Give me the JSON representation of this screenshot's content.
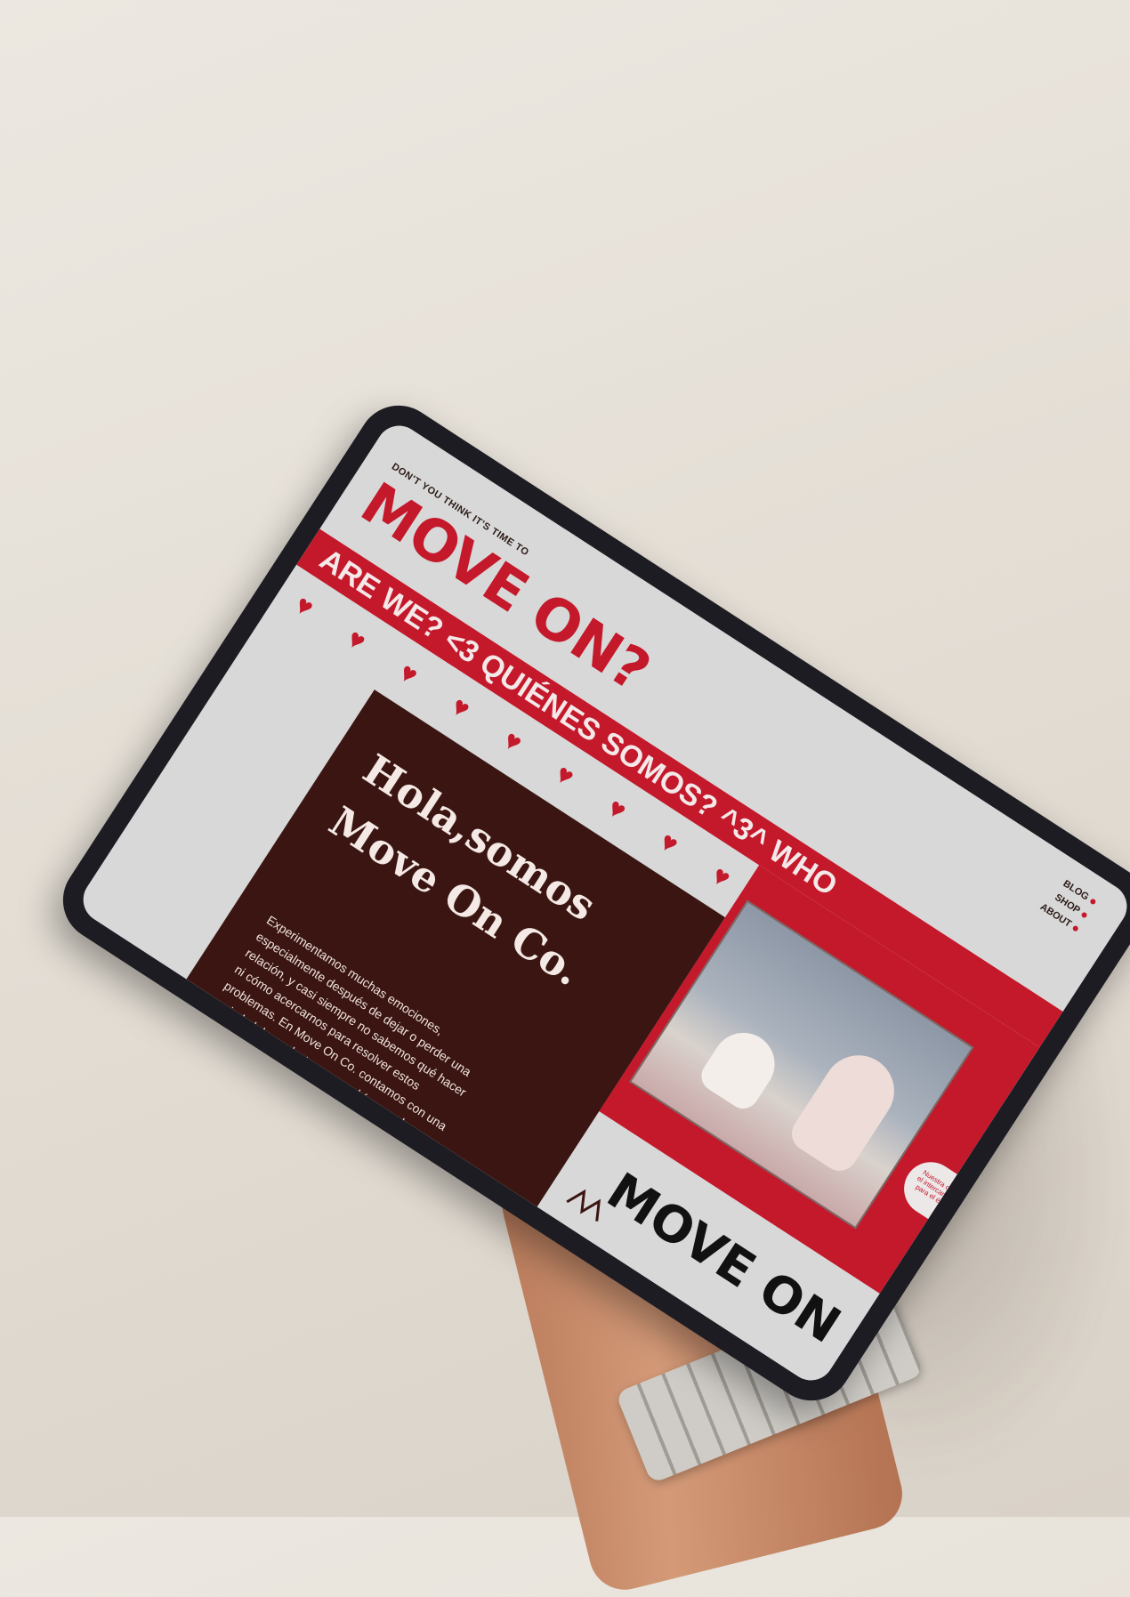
{
  "site": {
    "tagline": "DON'T YOU THINK IT'S TIME TO",
    "headline": "MOVE ON?",
    "nav": [
      {
        "label": "BLOG"
      },
      {
        "label": "SHOP"
      },
      {
        "label": "ABOUT"
      }
    ],
    "marquee": "ARE WE? <3  QUIÉNES SOMOS? ^3^ WHO",
    "intro_heading": "Hola,somos Move On Co.",
    "intro_body": "Experimentamos muchas emociones, especialmente después de dejar o perder una relación, y casi siempre no sabemos qué hacer ni cómo acercarnos para resolver estos problemas. En Move On Co. contamos con una variedad de productos que podrían ser de gran ayuda para superar rápidamente y de manera positiva estas situaciones.",
    "photo_note": "Nuestra organización permite el intercambio de experiencias para el éxito de la compañía",
    "footer_brand": "MOVE ON"
  },
  "colors": {
    "accent": "#c4182b",
    "brown": "#3a1512",
    "light": "#d8d8d8"
  },
  "icons": [
    "heart-dagger-icon"
  ]
}
